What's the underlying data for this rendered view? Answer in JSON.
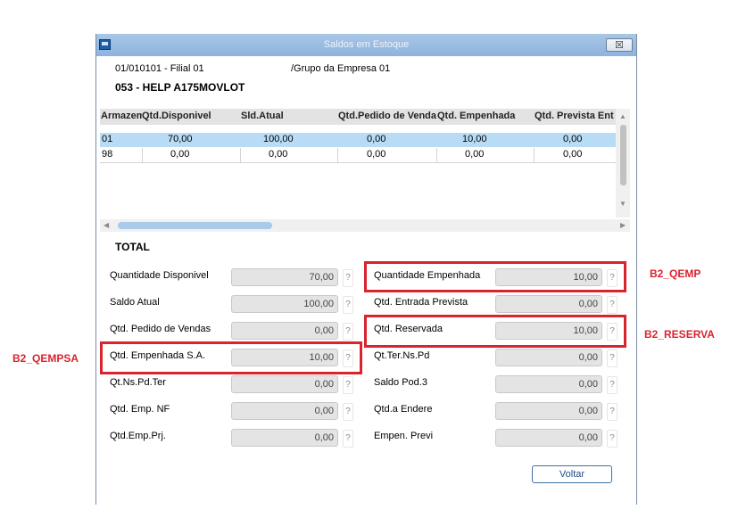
{
  "window": {
    "title": "Saldos em Estoque",
    "close_symbol": "☒"
  },
  "header": {
    "code": "01/010101 - Filial 01",
    "group": "/Grupo da Empresa 01",
    "product": "053 - HELP A175MOVLOT"
  },
  "grid": {
    "columns": [
      "Armazem",
      "Qtd.Disponivel",
      "Sld.Atual",
      "Qtd.Pedido de Venda",
      "Qtd. Empenhada",
      "Qtd. Prevista Ent"
    ],
    "rows": [
      [
        "01",
        "70,00",
        "100,00",
        "0,00",
        "10,00",
        "0,00"
      ],
      [
        "98",
        "0,00",
        "0,00",
        "0,00",
        "0,00",
        "0,00"
      ]
    ]
  },
  "totals": {
    "title": "TOTAL",
    "help": "?",
    "left": [
      {
        "label": "Quantidade Disponivel",
        "value": "70,00"
      },
      {
        "label": "Saldo Atual",
        "value": "100,00"
      },
      {
        "label": "Qtd. Pedido de Vendas",
        "value": "0,00"
      },
      {
        "label": "Qtd. Empenhada S.A.",
        "value": "10,00"
      },
      {
        "label": "Qt.Ns.Pd.Ter",
        "value": "0,00"
      },
      {
        "label": "Qtd. Emp. NF",
        "value": "0,00"
      },
      {
        "label": "Qtd.Emp.Prj.",
        "value": "0,00"
      }
    ],
    "right": [
      {
        "label": "Quantidade Empenhada",
        "value": "10,00"
      },
      {
        "label": "Qtd. Entrada Prevista",
        "value": "0,00"
      },
      {
        "label": "Qtd. Reservada",
        "value": "10,00"
      },
      {
        "label": "Qt.Ter.Ns.Pd",
        "value": "0,00"
      },
      {
        "label": "Saldo Pod.3",
        "value": "0,00"
      },
      {
        "label": "Qtd.a Endere",
        "value": "0,00"
      },
      {
        "label": "Empen. Previ",
        "value": "0,00"
      }
    ]
  },
  "buttons": {
    "back": "Voltar"
  },
  "annotations": {
    "qemp": "B2_QEMP",
    "reserva": "B2_RESERVA",
    "qempsa": "B2_QEMPSA"
  },
  "colors": {
    "highlight_row": "#b8dcf5",
    "annotation_red": "#d9232e",
    "title_bar": "#8db3de"
  },
  "icons": {
    "window": "window-app-icon",
    "close": "close-icon",
    "help": "help-question-icon"
  }
}
